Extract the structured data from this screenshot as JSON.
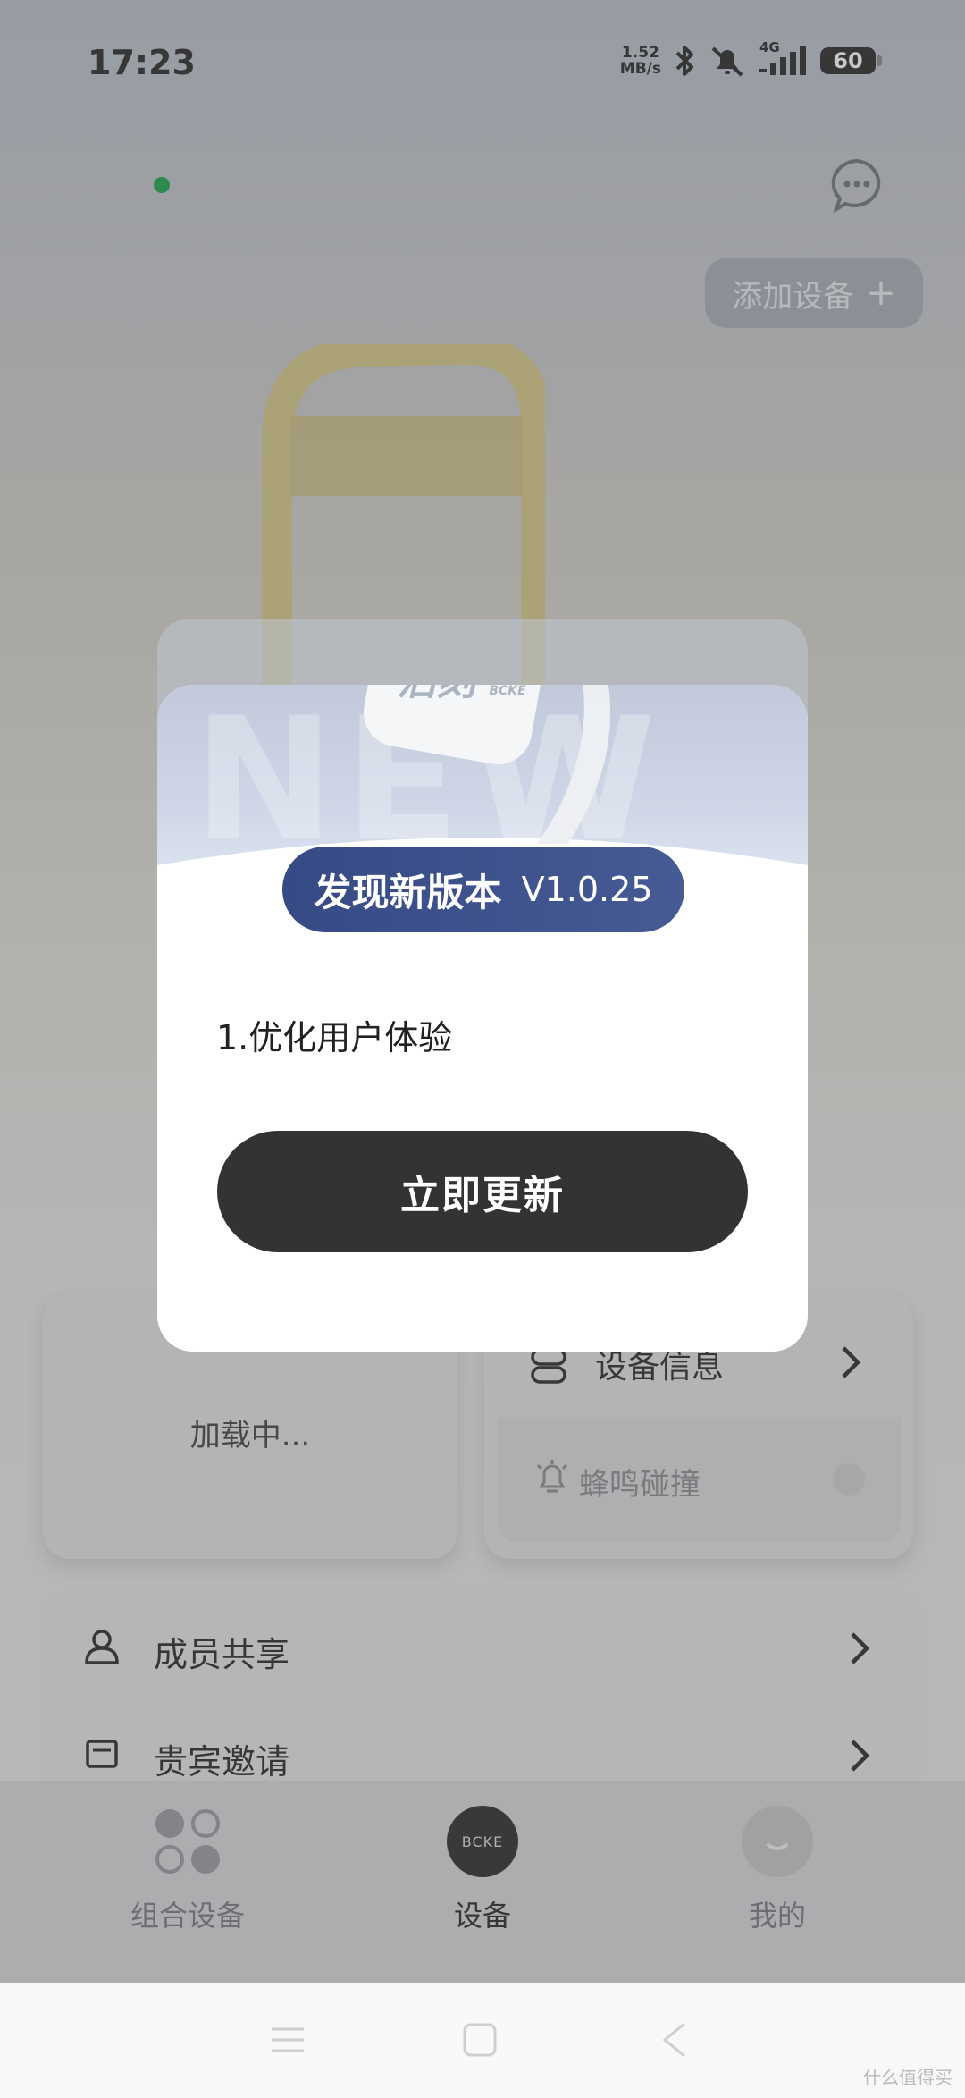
{
  "status_bar": {
    "time": "17:23",
    "net_speed_value": "1.52",
    "net_speed_unit": "MB/s",
    "network_type": "4G",
    "battery": "60"
  },
  "header": {
    "add_device_label": "添加设备",
    "add_icon": "plus-icon",
    "chat_icon": "chat-bubble-icon"
  },
  "cards": {
    "left_loading": "加载中...",
    "device_info_label": "设备信息",
    "buzz_collision_label": "蜂鸣碰撞"
  },
  "menu": {
    "items": [
      {
        "label": "成员共享",
        "icon": "person-icon"
      },
      {
        "label": "贵宾邀请",
        "icon": "invite-icon"
      }
    ]
  },
  "tabs": [
    {
      "label": "组合设备",
      "icon": "grid-dots-icon",
      "active": false
    },
    {
      "label": "设备",
      "icon": "bcke-logo-icon",
      "active": true,
      "logo_text": "BCKE"
    },
    {
      "label": "我的",
      "icon": "avatar-icon",
      "active": false
    }
  ],
  "dialog": {
    "banner_text": "NEW",
    "logo_text": "泊刻",
    "logo_sub": "BCKE",
    "title": "发现新版本",
    "version": "V1.0.25",
    "changelog": "1.优化用户体验",
    "update_button": "立即更新"
  },
  "watermark": "什么值得买",
  "colors": {
    "pill_blue": "#3a4e8a",
    "button_dark": "#333333",
    "online_green": "#1ea44a"
  }
}
